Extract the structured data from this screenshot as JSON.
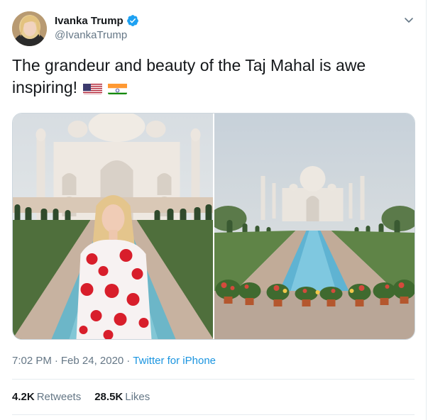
{
  "author": {
    "name": "Ivanka Trump",
    "handle": "@IvankaTrump",
    "verified_color": "#1da1f2"
  },
  "tweet": {
    "text": "The grandeur and beauty of the Taj Mahal is awe inspiring!",
    "emojis": [
      "flag-united-states",
      "flag-india"
    ]
  },
  "media": {
    "photo_count": 2
  },
  "meta": {
    "time": "7:02 PM",
    "separator": "·",
    "date": "Feb 24, 2020",
    "source": "Twitter for iPhone"
  },
  "stats": {
    "retweets_count": "4.2K",
    "retweets_label": "Retweets",
    "likes_count": "28.5K",
    "likes_label": "Likes"
  },
  "colors": {
    "link": "#1b95e0",
    "secondary_text": "#657786",
    "border": "#e6ecf0"
  }
}
